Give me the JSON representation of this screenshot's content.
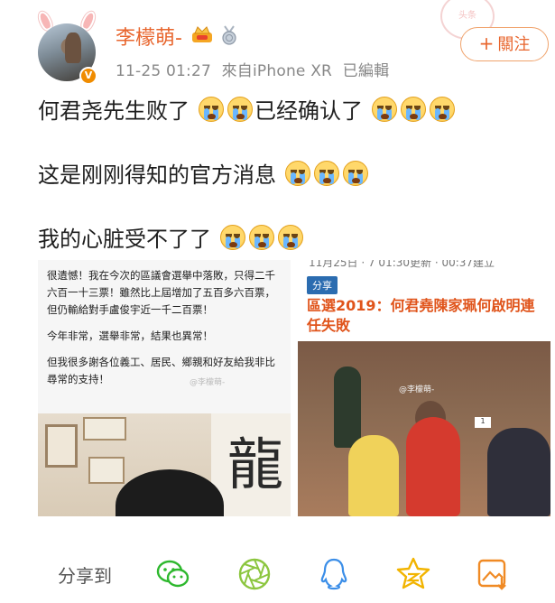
{
  "user": {
    "name": "李檬萌-",
    "verified_badge": "V",
    "avatar_desc": "avatar"
  },
  "stamp_text": "头条",
  "meta": {
    "time": "11-25 01:27",
    "source": "來自iPhone XR",
    "edited": "已編輯"
  },
  "follow": {
    "plus": "+",
    "label": "關注"
  },
  "post": {
    "line1": "何君尧先生败了",
    "line1_mid": "已经确认了",
    "line2": "这是刚刚得知的官方消息",
    "line3": "我的心脏受不了了"
  },
  "image_left": {
    "paragraphs": [
      "很遺憾！我在今次的區議會選舉中落敗，只得二千六百一十三票！雖然比上屆增加了五百多六百票，但仍輸給對手盧俊宇近一千二百票！",
      "今年非常，選舉非常，結果也異常！",
      "但我很多謝各位義工、居民、鄉親和好友給我非比尋常的支持！"
    ],
    "watermark": "@李檬萌-",
    "calligraphy": "龍"
  },
  "image_right": {
    "cut_text": "11月25日 · 7 01:30更新 · 00:37建立",
    "tag": "分享",
    "headline": "區選2019：何君堯陳家珮何啟明連任失敗",
    "watermark": "@李檬萌-",
    "sign": "1"
  },
  "toolbar": {
    "share_label": "分享到",
    "icons": [
      "wechat-icon",
      "moments-icon",
      "qq-icon",
      "qzone-icon",
      "save-image-icon"
    ]
  },
  "colors": {
    "accent": "#e8662e",
    "icon_green": "#2eb82e",
    "icon_lime": "#8cc63f",
    "icon_blue": "#3b8ee8",
    "icon_yellow": "#f2b400",
    "icon_orange": "#f08a24"
  }
}
